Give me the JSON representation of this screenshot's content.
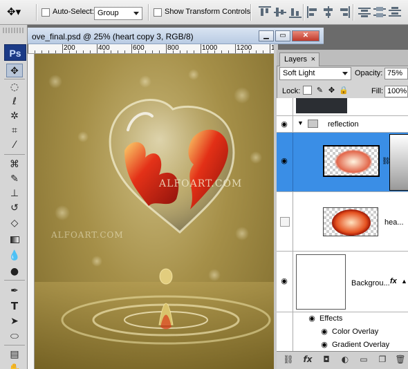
{
  "options_bar": {
    "auto_select_label": "Auto-Select:",
    "auto_select_value": "Group",
    "show_transform_label": "Show Transform Controls"
  },
  "tools_panel": {
    "logo": "Ps",
    "tools": [
      "move-tool",
      "marquee-tool",
      "lasso-tool",
      "magic-wand-tool",
      "crop-tool",
      "eyedropper-tool",
      "healing-tool",
      "brush-tool",
      "clone-stamp-tool",
      "history-brush-tool",
      "eraser-tool",
      "gradient-tool",
      "blur-tool",
      "dodge-tool",
      "pen-tool",
      "type-tool",
      "path-selection-tool",
      "shape-tool",
      "notes-tool",
      "hand-tool"
    ]
  },
  "document": {
    "title": "ove_final.psd @ 25% (heart copy 3, RGB/8)",
    "ruler_labels": [
      "200",
      "400",
      "600",
      "800",
      "1000",
      "1200",
      "1400",
      "1600"
    ],
    "watermarks": [
      "ALFOART.COM",
      "ALFOART.COM"
    ]
  },
  "layers_panel": {
    "tab_label": "Layers",
    "blend_mode": "Soft Light",
    "opacity_label": "Opacity:",
    "opacity_value": "75%",
    "lock_label": "Lock:",
    "fill_label": "Fill:",
    "fill_value": "100%",
    "group_name": "reflection",
    "layer_heart_name": "hea...",
    "background_name": "Backgrou...",
    "fx_label": "fx",
    "effects_label": "Effects",
    "effect_items": [
      "Color Overlay",
      "Gradient Overlay"
    ]
  },
  "colors": {
    "selection": "#3a8ee6",
    "panel": "#d4d4d4",
    "ps_logo": "#1b3a86"
  }
}
